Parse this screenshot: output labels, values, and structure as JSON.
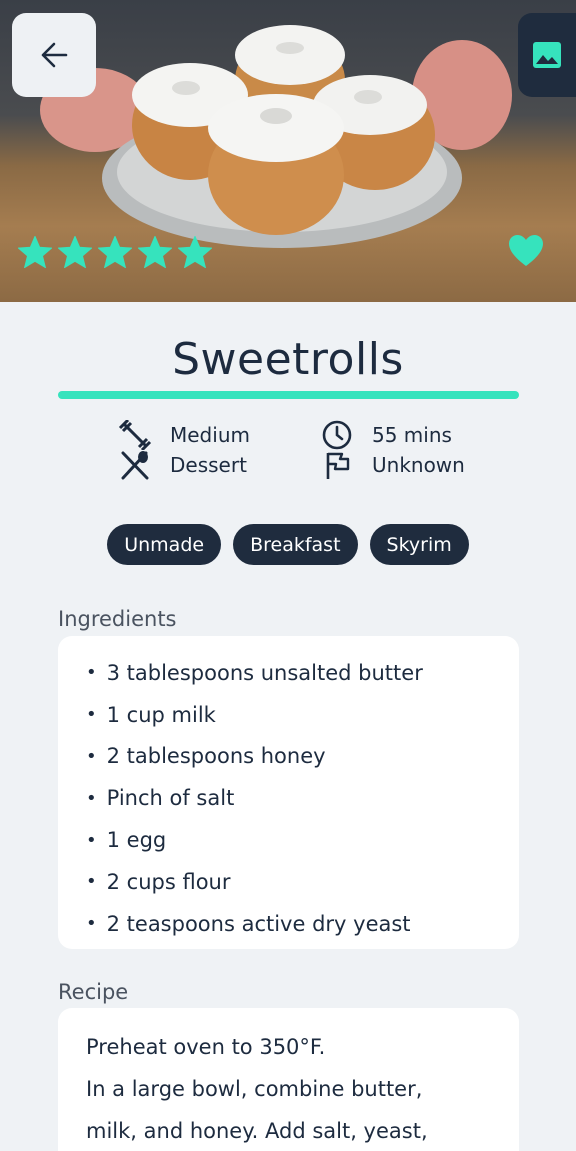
{
  "recipe": {
    "name": "Sweetrolls",
    "rating": 5,
    "favorite": true,
    "difficulty": "Medium",
    "time": "55 mins",
    "course": "Dessert",
    "origin": "Unknown",
    "tags": [
      "Unmade",
      "Breakfast",
      "Skyrim"
    ]
  },
  "sections": {
    "ingredients_label": "Ingredients",
    "recipe_label": "Recipe"
  },
  "ingredients": [
    "3 tablespoons unsalted butter",
    "1 cup milk",
    "2 tablespoons honey",
    "Pinch of salt",
    "1 egg",
    "2 cups flour",
    "2 teaspoons active dry yeast"
  ],
  "instructions": [
    "Preheat oven to 350°F.",
    "In a large bowl, combine butter,",
    "milk, and honey. Add salt, yeast,"
  ],
  "icons": {
    "back": "arrow-left-icon",
    "gallery": "image-icon",
    "rating": "star-icon",
    "favorite": "heart-icon",
    "difficulty": "dumbbell-icon",
    "time": "clock-icon",
    "course": "utensils-icon",
    "origin": "flag-icon"
  },
  "colors": {
    "accent": "#36e3bd",
    "dark": "#1f2c3e",
    "background": "#eff2f5"
  }
}
